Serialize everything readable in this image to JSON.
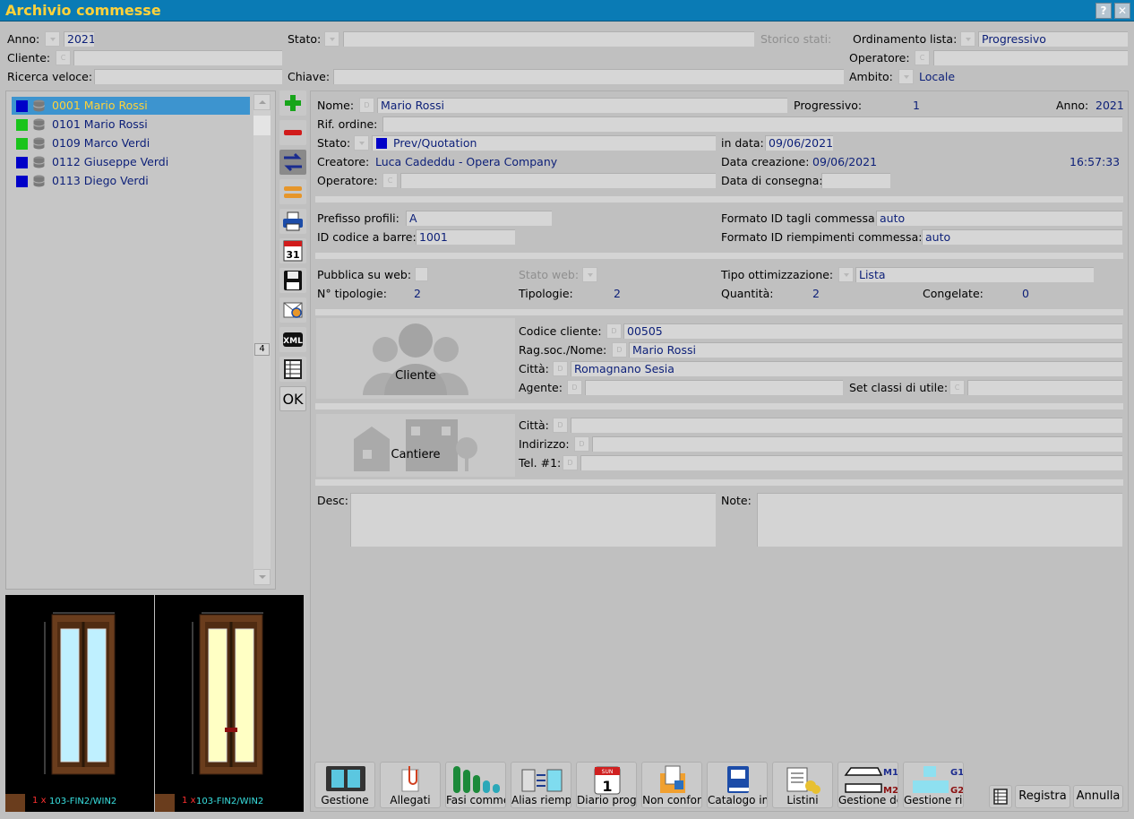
{
  "window": {
    "title": "Archivio commesse",
    "help": "?",
    "close": "✕"
  },
  "filters": {
    "anno_label": "Anno:",
    "anno_value": "2021",
    "stato_label": "Stato:",
    "stato_value": "",
    "storico_label": "Storico stati:",
    "ordinamento_label": "Ordinamento lista:",
    "ordinamento_value": "Progressivo",
    "cliente_label": "Cliente:",
    "cliente_value": "",
    "operatore_label": "Operatore:",
    "operatore_value": "",
    "ricerca_label": "Ricerca veloce:",
    "ricerca_value": "",
    "chiave_label": "Chiave:",
    "chiave_value": "",
    "ambito_label": "Ambito:",
    "ambito_value": "Locale"
  },
  "list": [
    {
      "text": "0001 Mario Rossi",
      "color": "#0000c8",
      "selected": true
    },
    {
      "text": "0101 Mario Rossi",
      "color": "#19c41b",
      "selected": false
    },
    {
      "text": "0109 Marco Verdi",
      "color": "#19c41b",
      "selected": false
    },
    {
      "text": "0112 Giuseppe Verdi",
      "color": "#0000c8",
      "selected": false
    },
    {
      "text": "0113 Diego Verdi",
      "color": "#0000c8",
      "selected": false
    }
  ],
  "scroll_marker": "4",
  "tools": {
    "cal_num": "31",
    "xml": "XML",
    "ok": "OK"
  },
  "details": {
    "nome_label": "Nome:",
    "nome_value": "Mario Rossi",
    "progressivo_label": "Progressivo:",
    "progressivo_value": "1",
    "anno_label": "Anno:",
    "anno_value": "2021",
    "rif_label": "Rif. ordine:",
    "stato_label": "Stato:",
    "stato_value": "Prev/Quotation",
    "stato_color": "#0000c8",
    "indata_label": "in data:",
    "indata_value": "09/06/2021",
    "creatore_label": "Creatore:",
    "creatore_value": "Luca Cadeddu - Opera Company",
    "datacre_label": "Data creazione:",
    "datacre_value": "09/06/2021",
    "time_value": "16:57:33",
    "operatore_label": "Operatore:",
    "consegna_label": "Data di consegna:",
    "prefisso_label": "Prefisso profili:",
    "prefisso_value": "A",
    "barre_label": "ID codice a barre:",
    "barre_value": "1001",
    "tagli_label": "Formato ID tagli commessa:",
    "tagli_value": "auto",
    "riemp_label": "Formato ID riempimenti commessa:",
    "riemp_value": "auto",
    "web_label": "Pubblica su web:",
    "statoweb_label": "Stato web:",
    "ottim_label": "Tipo ottimizzazione:",
    "ottim_value": "Lista",
    "ntip_label": "N° tipologie:",
    "ntip_value": "2",
    "tip_label": "Tipologie:",
    "tip_value": "2",
    "qta_label": "Quantità:",
    "qta_value": "2",
    "cong_label": "Congelate:",
    "cong_value": "0",
    "cliente_caption": "Cliente",
    "codcli_label": "Codice cliente:",
    "codcli_value": "00505",
    "ragsoc_label": "Rag.soc./Nome:",
    "ragsoc_value": "Mario Rossi",
    "citta_label": "Città:",
    "citta_value": "Romagnano Sesia",
    "agente_label": "Agente:",
    "setclassi_label": "Set classi di utile:",
    "cantiere_caption": "Cantiere",
    "c_citta_label": "Città:",
    "c_indirizzo_label": "Indirizzo:",
    "c_tel_label": "Tel. #1:",
    "desc_label": "Desc:",
    "note_label": "Note:",
    "mark_d": "D",
    "mark_c": "C"
  },
  "thumbs": [
    {
      "qty": "1",
      "mult": "x",
      "code": "103-FIN2/WIN2"
    },
    {
      "qty": "1",
      "mult": "x",
      "code": "103-FIN2/WIN2"
    }
  ],
  "bottom": {
    "gestione": "Gestione",
    "allegati": "Allegati",
    "fasi": "Fasi comme",
    "alias": "Alias riemp.",
    "diario": "Diario proge",
    "nonconf": "Non confor",
    "catalogo": "Catalogo im",
    "listini": "Listini",
    "gestde": "Gestione de",
    "gestrie": "Gestione rie",
    "m1": "M1",
    "m2": "M2",
    "g1": "G1",
    "g2": "G2",
    "sun": "SUN",
    "one": "1",
    "registra": "Registra",
    "annulla": "Annulla"
  }
}
